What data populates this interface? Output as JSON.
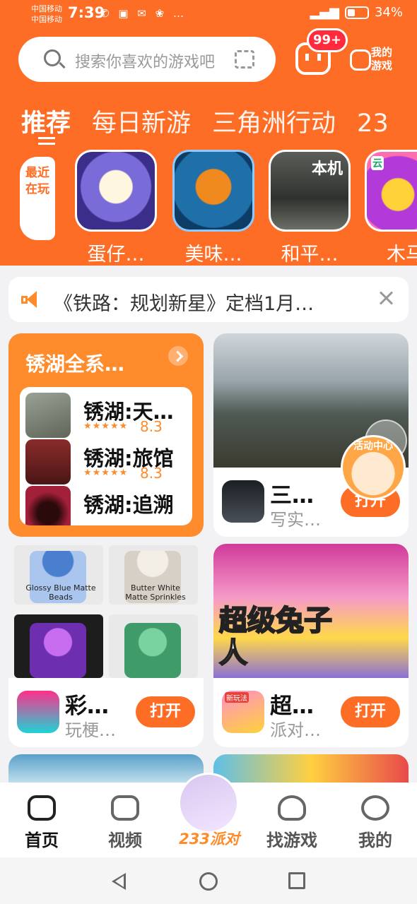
{
  "status_bar": {
    "carrier1": "中国移动",
    "carrier2": "中国移动",
    "time": "7:39",
    "icons": "✆ ▣ ✉ ❀ …",
    "battery": "34%"
  },
  "header": {
    "search_placeholder": "搜索你喜欢的游戏吧",
    "message_badge": "99+",
    "my_games_label": "我的游戏",
    "tabs": [
      {
        "label": "推荐",
        "active": true
      },
      {
        "label": "每日新游",
        "active": false
      },
      {
        "label": "三角洲行动",
        "active": false
      },
      {
        "label": "23",
        "active": false
      }
    ],
    "recent_label": "最近在玩",
    "recent_games": [
      {
        "name": "蛋仔…",
        "tag": ""
      },
      {
        "name": "美味…",
        "tag": ""
      },
      {
        "name": "和平…",
        "tag": "本机"
      },
      {
        "name": "木马",
        "tag": "云"
      }
    ]
  },
  "notice": {
    "text": "《铁路：规划新星》定档1月…"
  },
  "collection": {
    "title": "锈湖全系…",
    "items": [
      {
        "name": "锈湖:天…",
        "stars": "★★★★★",
        "rating": "8.3"
      },
      {
        "name": "锈湖:旅馆",
        "stars": "★★★★★",
        "rating": "8.3"
      },
      {
        "name": "锈湖:追溯",
        "stars": "",
        "rating": ""
      }
    ]
  },
  "cards": [
    {
      "name": "三…",
      "sub": "写实…",
      "button": "打开"
    },
    {
      "name": "彩…",
      "sub": "玩梗…",
      "button": "打开"
    },
    {
      "name": "超…",
      "sub": "派对…",
      "button": "打开"
    }
  ],
  "slime_labels": [
    "Glossy Blue Matte Beads",
    "Butter White Matte Sprinkles"
  ],
  "bunny_title": "超级兔子人",
  "new_tag": "新玩法",
  "floating_activity": "活动中心",
  "bottom_nav": [
    {
      "label": "首页",
      "active": true
    },
    {
      "label": "视频",
      "active": false
    },
    {
      "label": "233派对",
      "active": false
    },
    {
      "label": "找游戏",
      "active": false
    },
    {
      "label": "我的",
      "active": false
    }
  ],
  "colors": {
    "brand": "#fe6d25",
    "accent": "#fe8b2c",
    "badge": "#ff2a3b"
  }
}
